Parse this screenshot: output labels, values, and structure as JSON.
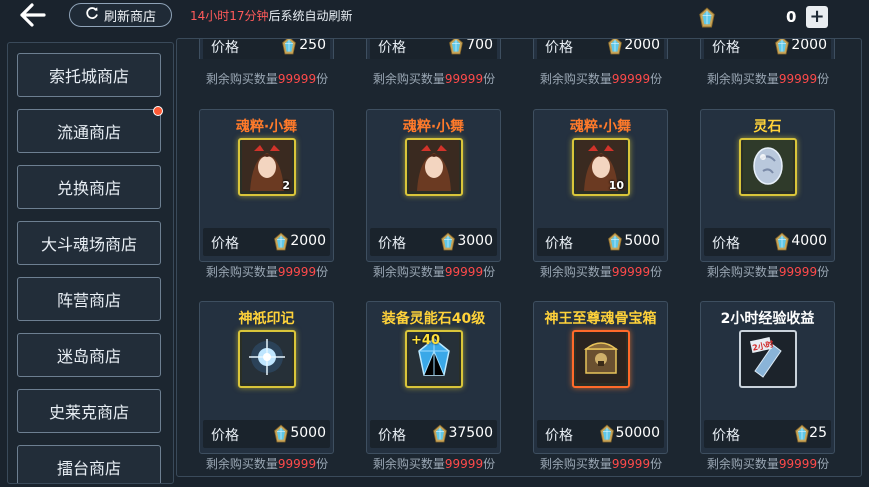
{
  "header": {
    "refresh_label": "刷新商店",
    "timer_text": "14小时17分钟",
    "timer_suffix": "后系统自动刷新",
    "currency_value": "0",
    "plus_label": "+"
  },
  "sidebar": {
    "items": [
      {
        "label": "索托城商店"
      },
      {
        "label": "流通商店"
      },
      {
        "label": "兑换商店"
      },
      {
        "label": "大斗魂场商店"
      },
      {
        "label": "阵营商店"
      },
      {
        "label": "迷岛商店"
      },
      {
        "label": "史莱克商店"
      },
      {
        "label": "擂台商店"
      }
    ]
  },
  "remain_text": {
    "prefix": "剩余购买数量",
    "count": "99999",
    "suffix": "份"
  },
  "price_label": "价格",
  "top_row": [
    {
      "price": "250"
    },
    {
      "price": "700"
    },
    {
      "price": "2000"
    },
    {
      "price": "2000"
    }
  ],
  "rows": [
    [
      {
        "name": "魂粹·小舞",
        "name_color": "#ff7a2a",
        "count": "2",
        "price": "2000",
        "icon": "xiaowu-portrait-icon"
      },
      {
        "name": "魂粹·小舞",
        "name_color": "#ff7a2a",
        "count": "",
        "price": "3000",
        "icon": "xiaowu-portrait-icon"
      },
      {
        "name": "魂粹·小舞",
        "name_color": "#ff7a2a",
        "count": "10",
        "price": "5000",
        "icon": "xiaowu-portrait-icon"
      },
      {
        "name": "灵石",
        "name_color": "#ffd23a",
        "count": "",
        "price": "4000",
        "icon": "spirit-stone-icon"
      }
    ],
    [
      {
        "name": "神祇印记",
        "name_color": "#ffd23a",
        "count": "",
        "price": "5000",
        "icon": "divine-mark-icon"
      },
      {
        "name": "装备灵能石40级",
        "name_color": "#ffd23a",
        "count": "+40",
        "price": "37500",
        "icon": "energy-stone-icon"
      },
      {
        "name": "神王至尊魂骨宝箱",
        "name_color": "#ffd23a",
        "count": "",
        "price": "50000",
        "icon": "soul-bone-chest-icon"
      },
      {
        "name": "2小时经验收益",
        "name_color": "#ffffff",
        "count": "",
        "price": "25",
        "icon": "exp-scroll-icon"
      }
    ]
  ]
}
